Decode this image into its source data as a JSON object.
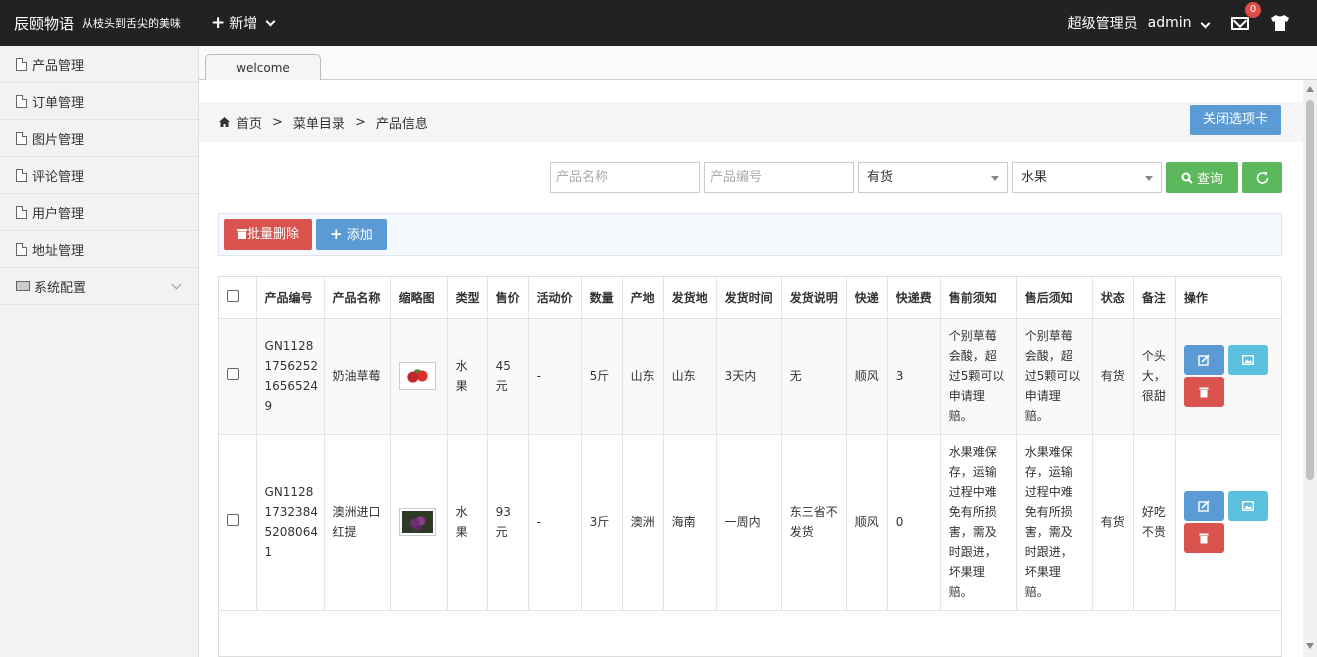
{
  "header": {
    "brand": "辰颐物语",
    "slogan": "从枝头到舌尖的美味",
    "add_label": "新增",
    "role": "超级管理员",
    "user": "admin",
    "mail_count": "0"
  },
  "sidebar": {
    "items": [
      {
        "label": "产品管理"
      },
      {
        "label": "订单管理"
      },
      {
        "label": "图片管理"
      },
      {
        "label": "评论管理"
      },
      {
        "label": "用户管理"
      },
      {
        "label": "地址管理"
      },
      {
        "label": "系统配置"
      }
    ]
  },
  "tabs": [
    {
      "label": "welcome"
    }
  ],
  "breadcrumb": {
    "home": "首页",
    "level1": "菜单目录",
    "level2": "产品信息"
  },
  "close_tab_label": "关闭选项卡",
  "search": {
    "name_placeholder": "产品名称",
    "code_placeholder": "产品编号",
    "stock_value": "有货",
    "category_value": "水果",
    "query_label": "查询"
  },
  "toolbar": {
    "batch_delete": "批量删除",
    "add": "添加"
  },
  "table": {
    "headers": [
      "产品编号",
      "产品名称",
      "缩略图",
      "类型",
      "售价",
      "活动价",
      "数量",
      "产地",
      "发货地",
      "发货时间",
      "发货说明",
      "快递",
      "快递费",
      "售前须知",
      "售后须知",
      "状态",
      "备注",
      "操作"
    ],
    "rows": [
      {
        "code": "GN1128 1756252 1656524 9",
        "name": "奶油草莓",
        "type": "水果",
        "price": "45 元",
        "promo": "-",
        "qty": "5斤",
        "origin": "山东",
        "ship_from": "山东",
        "ship_time": "3天内",
        "ship_note": "无",
        "courier": "顺风",
        "fee": "3",
        "pre_sale": "个别草莓会酸，超过5颗可以申请理赔。",
        "after_sale": "个别草莓会酸，超过5颗可以申请理赔。",
        "status": "有货",
        "remark": "个头大，很甜"
      },
      {
        "code": "GN1128 1732384 5208064 1",
        "name": "澳洲进口红提",
        "type": "水果",
        "price": "93 元",
        "promo": "-",
        "qty": "3斤",
        "origin": "澳洲",
        "ship_from": "海南",
        "ship_time": "一周内",
        "ship_note": "东三省不发货",
        "courier": "顺风",
        "fee": "0",
        "pre_sale": "水果难保存，运输过程中难免有所损害，需及时跟进，坏果理赔。",
        "after_sale": "水果难保存，运输过程中难免有所损害，需及时跟进，坏果理赔。",
        "status": "有货",
        "remark": "好吃不贵"
      }
    ]
  },
  "colors": {
    "topbar": "#222222",
    "primary": "#5b9bd5",
    "success": "#5cb85c",
    "danger": "#d9534f",
    "info": "#5bc0de"
  }
}
